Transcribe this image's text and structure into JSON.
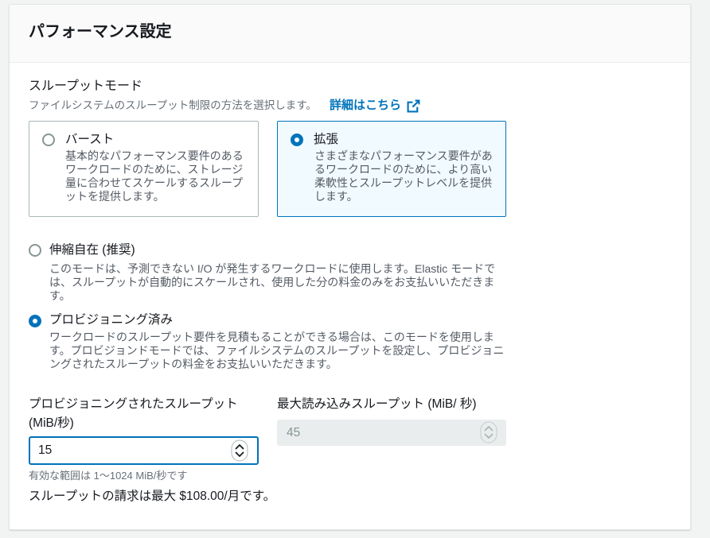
{
  "theme": {
    "accent": "#0073bb",
    "text": "#16191f",
    "muted": "#687078",
    "description": "#545b64",
    "selected_tile_bg": "#f1faff",
    "tile_border": "#aab7b8",
    "radio_border": "#879596",
    "disabled_bg": "#eaeded",
    "disabled_text": "#879596",
    "page_bg": "#f2f3f3",
    "header_bg": "#fafafa"
  },
  "panel": {
    "title": "パフォーマンス設定"
  },
  "throughput_mode": {
    "label": "スループットモード",
    "description": "ファイルシステムのスループット制限の方法を選択します。",
    "info_link": {
      "label": "詳細はこちら",
      "icon": "external-link-icon"
    },
    "tiles": [
      {
        "title": "バースト",
        "description": "基本的なパフォーマンス要件のあるワークロードのために、ストレージ量に合わせてスケールするスループットを提供します。",
        "selected": false
      },
      {
        "title": "拡張",
        "description": "さまざまなパフォーマンス要件があるワークロードのために、より高い柔軟性とスループットレベルを提供します。",
        "selected": true
      }
    ],
    "options": [
      {
        "label": "伸縮自在 (推奨)",
        "description": "このモードは、予測できない I/O が発生するワークロードに使用します。Elastic モードでは、スループットが自動的にスケールされ、使用した分の料金のみをお支払いいただきます。",
        "selected": false
      },
      {
        "label": "プロビジョニング済み",
        "description": "ワークロードのスループット要件を見積もることができる場合は、このモードを使用します。プロビジョンドモードでは、ファイルシステムのスループットを設定し、プロビジョニングされたスループットの料金をお支払いいただきます。",
        "selected": true
      }
    ]
  },
  "provisioned_throughput": {
    "label": "プロビジョニングされたスループット (MiB/秒)",
    "value": "15",
    "constraint": "有効な範囲は 1〜1024 MiB/秒です",
    "stepper_icon": "stepper-icon"
  },
  "max_read_throughput": {
    "label": "最大読み込みスループット (MiB/ 秒)",
    "value": "45",
    "disabled": true,
    "stepper_icon": "stepper-icon"
  },
  "billing_note": "スループットの請求は最大 $108.00/月です。"
}
